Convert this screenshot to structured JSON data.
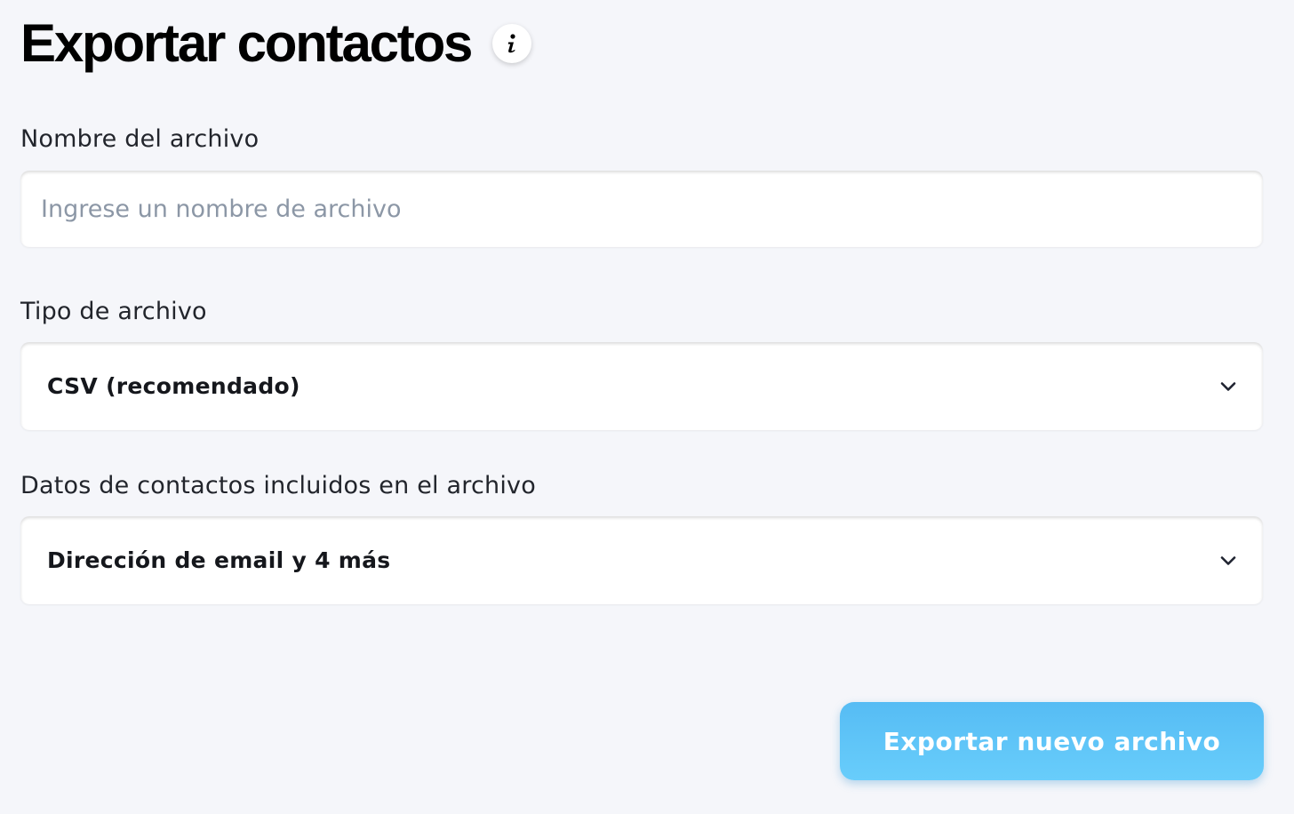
{
  "page": {
    "title": "Exportar contactos",
    "info_icon": "info-icon"
  },
  "filename": {
    "label": "Nombre del archivo",
    "value": "",
    "placeholder": "Ingrese un nombre de archivo"
  },
  "filetype": {
    "label": "Tipo de archivo",
    "selected": "CSV (recomendado)",
    "icon": "chevron-down-icon"
  },
  "contact_data": {
    "label": "Datos de contactos incluidos en el archivo",
    "selected": "Dirección de email y 4 más",
    "icon": "chevron-down-icon"
  },
  "actions": {
    "export_label": "Exportar nuevo archivo"
  },
  "colors": {
    "background": "#f5f6fa",
    "primary_button": "#5cc2f7",
    "placeholder": "#8c97a6"
  }
}
